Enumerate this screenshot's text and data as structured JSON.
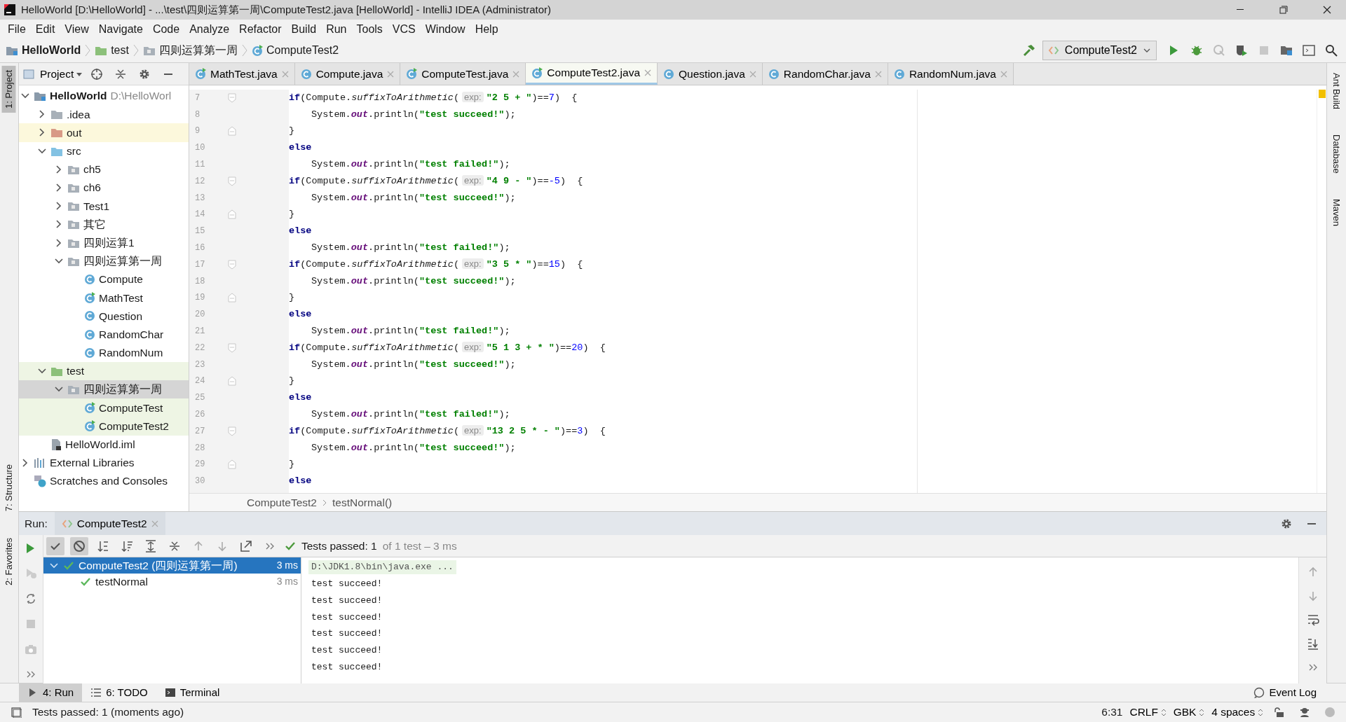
{
  "window": {
    "title": "HelloWorld [D:\\HelloWorld] - ...\\test\\四则运算第一周\\ComputeTest2.java [HelloWorld] - IntelliJ IDEA (Administrator)"
  },
  "menu": [
    "File",
    "Edit",
    "View",
    "Navigate",
    "Code",
    "Analyze",
    "Refactor",
    "Build",
    "Run",
    "Tools",
    "VCS",
    "Window",
    "Help"
  ],
  "breadcrumbs": [
    {
      "label": "HelloWorld",
      "kind": "module"
    },
    {
      "label": "test",
      "kind": "test-folder"
    },
    {
      "label": "四则运算第一周",
      "kind": "package"
    },
    {
      "label": "ComputeTest2",
      "kind": "test-class"
    }
  ],
  "run_config": {
    "label": "ComputeTest2"
  },
  "left_stripe": [
    {
      "label": "1: Project",
      "selected": true
    },
    {
      "label": "7: Structure",
      "selected": false
    },
    {
      "label": "2: Favorites",
      "selected": false
    }
  ],
  "right_stripe": [
    {
      "label": "Ant Build"
    },
    {
      "label": "Database"
    },
    {
      "label": "Maven"
    }
  ],
  "project_panel": {
    "title": "Project",
    "tree": [
      {
        "label": "HelloWorld",
        "path": "D:\\HelloWorl",
        "kind": "module",
        "expanded": true,
        "selected": false,
        "children": [
          {
            "label": ".idea",
            "kind": "folder",
            "expanded": false,
            "selected": false
          },
          {
            "label": "out",
            "kind": "excluded-folder",
            "expanded": false,
            "selected": false
          },
          {
            "label": "src",
            "kind": "source-folder",
            "expanded": true,
            "selected": false,
            "children": [
              {
                "label": "ch5",
                "kind": "package",
                "expanded": false,
                "selected": false
              },
              {
                "label": "ch6",
                "kind": "package",
                "expanded": false,
                "selected": false
              },
              {
                "label": "Test1",
                "kind": "package",
                "expanded": false,
                "selected": false
              },
              {
                "label": "其它",
                "kind": "package",
                "expanded": false,
                "selected": false
              },
              {
                "label": "四则运算1",
                "kind": "package",
                "expanded": false,
                "selected": false
              },
              {
                "label": "四则运算第一周",
                "kind": "package",
                "expanded": true,
                "selected": false,
                "children": [
                  {
                    "label": "Compute",
                    "kind": "class",
                    "selected": false
                  },
                  {
                    "label": "MathTest",
                    "kind": "test-class",
                    "selected": false
                  },
                  {
                    "label": "Question",
                    "kind": "class",
                    "selected": false
                  },
                  {
                    "label": "RandomChar",
                    "kind": "class",
                    "selected": false
                  },
                  {
                    "label": "RandomNum",
                    "kind": "class",
                    "selected": false
                  }
                ]
              }
            ]
          },
          {
            "label": "test",
            "kind": "test-folder",
            "expanded": true,
            "selected": false,
            "children": [
              {
                "label": "四则运算第一周",
                "kind": "test-package",
                "expanded": true,
                "selected": true,
                "children": [
                  {
                    "label": "ComputeTest",
                    "kind": "test-source-class",
                    "selected": false
                  },
                  {
                    "label": "ComputeTest2",
                    "kind": "test-source-class",
                    "selected": false
                  }
                ]
              }
            ]
          },
          {
            "label": "HelloWorld.iml",
            "kind": "file",
            "selected": false
          }
        ]
      },
      {
        "label": "External Libraries",
        "kind": "library",
        "expanded": false,
        "selected": false
      },
      {
        "label": "Scratches and Consoles",
        "kind": "scratches",
        "selected": false
      }
    ]
  },
  "tabs": [
    {
      "label": "MathTest.java",
      "kind": "test-class",
      "selected": false
    },
    {
      "label": "Compute.java",
      "kind": "class",
      "selected": false
    },
    {
      "label": "ComputeTest.java",
      "kind": "test-class",
      "selected": false
    },
    {
      "label": "ComputeTest2.java",
      "kind": "test-class",
      "selected": true
    },
    {
      "label": "Question.java",
      "kind": "class",
      "selected": false
    },
    {
      "label": "RandomChar.java",
      "kind": "class",
      "selected": false
    },
    {
      "label": "RandomNum.java",
      "kind": "class",
      "selected": false
    }
  ],
  "editor": {
    "lines": [
      {
        "number": "7",
        "kind": "block-start",
        "tokens": [
          {
            "kind": "kw",
            "text": "if"
          },
          {
            "kind": "plain",
            "text": "(Compute."
          },
          {
            "kind": "method",
            "text": "suffixToArithmetic"
          },
          {
            "kind": "plain",
            "text": "("
          },
          {
            "kind": "hint",
            "text": "exp:"
          },
          {
            "kind": "str",
            "text": "\"2 5 + \""
          },
          {
            "kind": "plain",
            "text": ")=="
          },
          {
            "kind": "num",
            "text": "7"
          },
          {
            "kind": "plain",
            "text": ")  {"
          }
        ]
      },
      {
        "number": "8",
        "kind": "nested",
        "tokens": [
          {
            "kind": "plain",
            "text": "System."
          },
          {
            "kind": "field",
            "text": "out"
          },
          {
            "kind": "plain",
            "text": ".println("
          },
          {
            "kind": "str",
            "text": "\"test succeed!\""
          },
          {
            "kind": "plain",
            "text": ");"
          }
        ]
      },
      {
        "number": "9",
        "kind": "block-end",
        "tokens": [
          {
            "kind": "plain",
            "text": "}"
          }
        ]
      },
      {
        "number": "10",
        "kind": "statement",
        "tokens": [
          {
            "kind": "kw",
            "text": "else"
          }
        ]
      },
      {
        "number": "11",
        "kind": "nested",
        "tokens": [
          {
            "kind": "plain",
            "text": "System."
          },
          {
            "kind": "field",
            "text": "out"
          },
          {
            "kind": "plain",
            "text": ".println("
          },
          {
            "kind": "str",
            "text": "\"test failed!\""
          },
          {
            "kind": "plain",
            "text": ");"
          }
        ]
      },
      {
        "number": "12",
        "kind": "block-start",
        "tokens": [
          {
            "kind": "kw",
            "text": "if"
          },
          {
            "kind": "plain",
            "text": "(Compute."
          },
          {
            "kind": "method",
            "text": "suffixToArithmetic"
          },
          {
            "kind": "plain",
            "text": "("
          },
          {
            "kind": "hint",
            "text": "exp:"
          },
          {
            "kind": "str",
            "text": "\"4 9 - \""
          },
          {
            "kind": "plain",
            "text": ")=="
          },
          {
            "kind": "num",
            "text": "-5"
          },
          {
            "kind": "plain",
            "text": ")  {"
          }
        ]
      },
      {
        "number": "13",
        "kind": "nested",
        "tokens": [
          {
            "kind": "plain",
            "text": "System."
          },
          {
            "kind": "field",
            "text": "out"
          },
          {
            "kind": "plain",
            "text": ".println("
          },
          {
            "kind": "str",
            "text": "\"test succeed!\""
          },
          {
            "kind": "plain",
            "text": ");"
          }
        ]
      },
      {
        "number": "14",
        "kind": "block-end",
        "tokens": [
          {
            "kind": "plain",
            "text": "}"
          }
        ]
      },
      {
        "number": "15",
        "kind": "statement",
        "tokens": [
          {
            "kind": "kw",
            "text": "else"
          }
        ]
      },
      {
        "number": "16",
        "kind": "nested",
        "tokens": [
          {
            "kind": "plain",
            "text": "System."
          },
          {
            "kind": "field",
            "text": "out"
          },
          {
            "kind": "plain",
            "text": ".println("
          },
          {
            "kind": "str",
            "text": "\"test failed!\""
          },
          {
            "kind": "plain",
            "text": ");"
          }
        ]
      },
      {
        "number": "17",
        "kind": "block-start",
        "tokens": [
          {
            "kind": "kw",
            "text": "if"
          },
          {
            "kind": "plain",
            "text": "(Compute."
          },
          {
            "kind": "method",
            "text": "suffixToArithmetic"
          },
          {
            "kind": "plain",
            "text": "("
          },
          {
            "kind": "hint",
            "text": "exp:"
          },
          {
            "kind": "str",
            "text": "\"3 5 * \""
          },
          {
            "kind": "plain",
            "text": ")=="
          },
          {
            "kind": "num",
            "text": "15"
          },
          {
            "kind": "plain",
            "text": ")  {"
          }
        ]
      },
      {
        "number": "18",
        "kind": "nested",
        "tokens": [
          {
            "kind": "plain",
            "text": "System."
          },
          {
            "kind": "field",
            "text": "out"
          },
          {
            "kind": "plain",
            "text": ".println("
          },
          {
            "kind": "str",
            "text": "\"test succeed!\""
          },
          {
            "kind": "plain",
            "text": ");"
          }
        ]
      },
      {
        "number": "19",
        "kind": "block-end",
        "tokens": [
          {
            "kind": "plain",
            "text": "}"
          }
        ]
      },
      {
        "number": "20",
        "kind": "statement",
        "tokens": [
          {
            "kind": "kw",
            "text": "else"
          }
        ]
      },
      {
        "number": "21",
        "kind": "nested",
        "tokens": [
          {
            "kind": "plain",
            "text": "System."
          },
          {
            "kind": "field",
            "text": "out"
          },
          {
            "kind": "plain",
            "text": ".println("
          },
          {
            "kind": "str",
            "text": "\"test failed!\""
          },
          {
            "kind": "plain",
            "text": ");"
          }
        ]
      },
      {
        "number": "22",
        "kind": "block-start",
        "tokens": [
          {
            "kind": "kw",
            "text": "if"
          },
          {
            "kind": "plain",
            "text": "(Compute."
          },
          {
            "kind": "method",
            "text": "suffixToArithmetic"
          },
          {
            "kind": "plain",
            "text": "("
          },
          {
            "kind": "hint",
            "text": "exp:"
          },
          {
            "kind": "str",
            "text": "\"5 1 3 + * \""
          },
          {
            "kind": "plain",
            "text": ")=="
          },
          {
            "kind": "num",
            "text": "20"
          },
          {
            "kind": "plain",
            "text": ")  {"
          }
        ]
      },
      {
        "number": "23",
        "kind": "nested",
        "tokens": [
          {
            "kind": "plain",
            "text": "System."
          },
          {
            "kind": "field",
            "text": "out"
          },
          {
            "kind": "plain",
            "text": ".println("
          },
          {
            "kind": "str",
            "text": "\"test succeed!\""
          },
          {
            "kind": "plain",
            "text": ");"
          }
        ]
      },
      {
        "number": "24",
        "kind": "block-end",
        "tokens": [
          {
            "kind": "plain",
            "text": "}"
          }
        ]
      },
      {
        "number": "25",
        "kind": "statement",
        "tokens": [
          {
            "kind": "kw",
            "text": "else"
          }
        ]
      },
      {
        "number": "26",
        "kind": "nested",
        "tokens": [
          {
            "kind": "plain",
            "text": "System."
          },
          {
            "kind": "field",
            "text": "out"
          },
          {
            "kind": "plain",
            "text": ".println("
          },
          {
            "kind": "str",
            "text": "\"test failed!\""
          },
          {
            "kind": "plain",
            "text": ");"
          }
        ]
      },
      {
        "number": "27",
        "kind": "block-start",
        "tokens": [
          {
            "kind": "kw",
            "text": "if"
          },
          {
            "kind": "plain",
            "text": "(Compute."
          },
          {
            "kind": "method",
            "text": "suffixToArithmetic"
          },
          {
            "kind": "plain",
            "text": "("
          },
          {
            "kind": "hint",
            "text": "exp:"
          },
          {
            "kind": "str",
            "text": "\"13 2 5 * - \""
          },
          {
            "kind": "plain",
            "text": ")=="
          },
          {
            "kind": "num",
            "text": "3"
          },
          {
            "kind": "plain",
            "text": ")  {"
          }
        ]
      },
      {
        "number": "28",
        "kind": "nested",
        "tokens": [
          {
            "kind": "plain",
            "text": "System."
          },
          {
            "kind": "field",
            "text": "out"
          },
          {
            "kind": "plain",
            "text": ".println("
          },
          {
            "kind": "str",
            "text": "\"test succeed!\""
          },
          {
            "kind": "plain",
            "text": ");"
          }
        ]
      },
      {
        "number": "29",
        "kind": "block-end",
        "tokens": [
          {
            "kind": "plain",
            "text": "}"
          }
        ]
      },
      {
        "number": "30",
        "kind": "statement",
        "tokens": [
          {
            "kind": "kw",
            "text": "else"
          }
        ]
      }
    ],
    "breadcrumbs": [
      "ComputeTest2",
      "testNormal()"
    ]
  },
  "run_panel": {
    "label": "Run:",
    "tab": "ComputeTest2",
    "status": "Tests passed: 1",
    "detail": "of 1 test – 3 ms",
    "tests": [
      {
        "label": "ComputeTest2 (四则运算第一周)",
        "time": "3 ms",
        "selected": true,
        "expanded": true,
        "children": [
          {
            "label": "testNormal",
            "time": "3 ms",
            "selected": false
          }
        ]
      }
    ],
    "console": [
      {
        "kind": "command",
        "text": "D:\\JDK1.8\\bin\\java.exe ..."
      },
      {
        "kind": "output",
        "text": "test succeed!"
      },
      {
        "kind": "output",
        "text": "test succeed!"
      },
      {
        "kind": "output",
        "text": "test succeed!"
      },
      {
        "kind": "output",
        "text": "test succeed!"
      },
      {
        "kind": "output",
        "text": "test succeed!"
      },
      {
        "kind": "output",
        "text": "test succeed!"
      }
    ]
  },
  "tool_tabs": [
    {
      "label": "4: Run",
      "kind": "run",
      "selected": true
    },
    {
      "label": "6: TODO",
      "kind": "todo",
      "selected": false
    },
    {
      "label": "Terminal",
      "kind": "terminal",
      "selected": false
    }
  ],
  "event_log": "Event Log",
  "status_bar": {
    "message": "Tests passed: 1 (moments ago)",
    "position": "6:31",
    "line_separator": "CRLF",
    "encoding": "GBK",
    "indent": "4 spaces"
  }
}
